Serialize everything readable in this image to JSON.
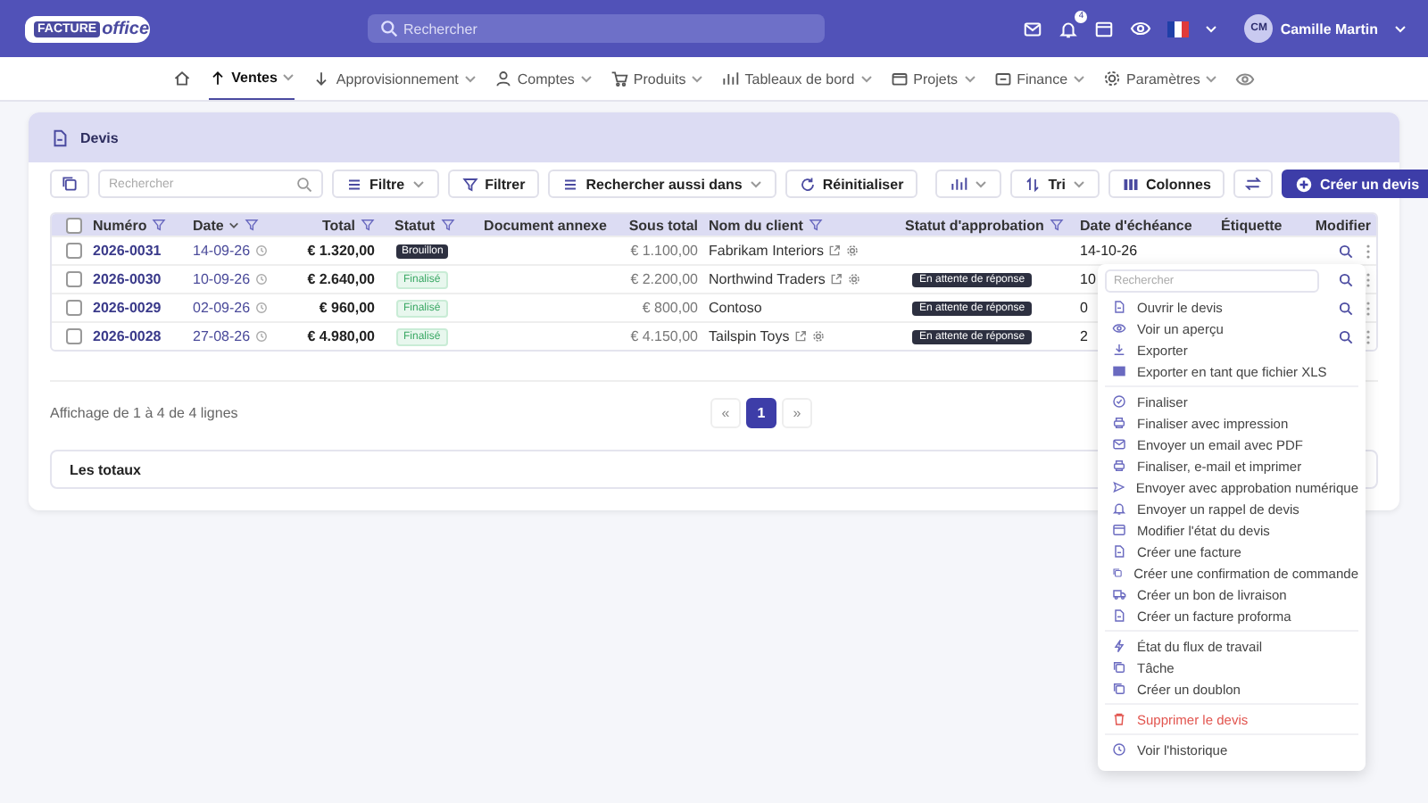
{
  "header": {
    "logo": {
      "part1": "FACTURE",
      "part2": "office"
    },
    "search": {
      "placeholder": "Rechercher"
    },
    "notifications_badge": "4",
    "user": {
      "initials": "CM",
      "name": "Camille Martin"
    }
  },
  "nav": [
    {
      "label": "Ventes",
      "selected": true
    },
    {
      "label": "Approvisionnement",
      "selected": false
    },
    {
      "label": "Comptes",
      "selected": false
    },
    {
      "label": "Produits",
      "selected": false
    },
    {
      "label": "Tableaux de bord",
      "selected": false
    },
    {
      "label": "Projets",
      "selected": false
    },
    {
      "label": "Finance",
      "selected": false
    },
    {
      "label": "Paramètres",
      "selected": false
    }
  ],
  "card": {
    "title": "Devis"
  },
  "toolbar": {
    "search": {
      "placeholder": "Rechercher"
    },
    "filter_menu": "Filtre",
    "filter": "Filtrer",
    "search_also": "Rechercher aussi dans",
    "reset": "Réinitialiser",
    "sort": "Tri",
    "columns": "Colonnes",
    "create": "Créer un devis"
  },
  "table": {
    "select_all_checked": false,
    "columns": [
      "Numéro",
      "Date",
      "Total",
      "Statut",
      "Document annexe",
      "Sous total",
      "Nom du client",
      "Statut d'approbation",
      "Date d'échéance",
      "Étiquette",
      "Modifier"
    ],
    "rows": [
      {
        "number": "2026-0031",
        "date": "14-09-26",
        "total": "€ 1.320,00",
        "status": {
          "label": "Brouillon",
          "kind": "draft"
        },
        "subtotal": "€ 1.100,00",
        "client": "Fabrikam Interiors",
        "client_links": true,
        "due": "14-10-26",
        "checked": false
      },
      {
        "number": "2026-0030",
        "date": "10-09-26",
        "total": "€ 2.640,00",
        "status": {
          "label": "Finalisé",
          "kind": "final"
        },
        "subtotal": "€ 2.200,00",
        "client": "Northwind Traders",
        "client_links": true,
        "approval": "En attente de réponse",
        "due": "10",
        "checked": false
      },
      {
        "number": "2026-0029",
        "date": "02-09-26",
        "total": "€ 960,00",
        "status": {
          "label": "Finalisé",
          "kind": "final"
        },
        "subtotal": "€ 800,00",
        "client": "Contoso",
        "client_links": false,
        "approval": "En attente de réponse",
        "due": "0",
        "checked": false
      },
      {
        "number": "2026-0028",
        "date": "27-08-26",
        "total": "€ 4.980,00",
        "status": {
          "label": "Finalisé",
          "kind": "final"
        },
        "subtotal": "€ 4.150,00",
        "client": "Tailspin Toys",
        "client_links": true,
        "approval": "En attente de réponse",
        "due": "2",
        "checked": false
      }
    ]
  },
  "footer": {
    "summary": "Affichage de 1 à 4 de 4 lignes",
    "pager": {
      "prev": "«",
      "pages": [
        {
          "label": "1",
          "selected": true
        }
      ],
      "next": "»"
    }
  },
  "totals": {
    "title": "Les totaux"
  },
  "menu": {
    "search": {
      "placeholder": "Rechercher"
    },
    "groups": [
      [
        {
          "label": "Ouvrir le devis",
          "danger": false
        },
        {
          "label": "Voir un aperçu",
          "danger": false
        },
        {
          "label": "Exporter",
          "danger": false
        },
        {
          "label": "Exporter en tant que fichier XLS",
          "danger": false
        }
      ],
      [
        {
          "label": "Finaliser",
          "danger": false
        },
        {
          "label": "Finaliser avec impression",
          "danger": false
        },
        {
          "label": "Envoyer un email avec PDF",
          "danger": false
        },
        {
          "label": "Finaliser, e-mail et imprimer",
          "danger": false
        },
        {
          "label": "Envoyer avec approbation numérique",
          "danger": false
        },
        {
          "label": "Envoyer un rappel de devis",
          "danger": false
        },
        {
          "label": "Modifier l'état du devis",
          "danger": false
        },
        {
          "label": "Créer une facture",
          "danger": false
        },
        {
          "label": "Créer une confirmation de commande",
          "danger": false
        },
        {
          "label": "Créer un bon de livraison",
          "danger": false
        },
        {
          "label": "Créer un facture proforma",
          "danger": false
        }
      ],
      [
        {
          "label": "État du flux de travail",
          "danger": false
        },
        {
          "label": "Tâche",
          "danger": false
        },
        {
          "label": "Créer un doublon",
          "danger": false
        }
      ],
      [
        {
          "label": "Supprimer le devis",
          "danger": true
        }
      ],
      [
        {
          "label": "Voir l'historique",
          "danger": false
        }
      ]
    ]
  }
}
